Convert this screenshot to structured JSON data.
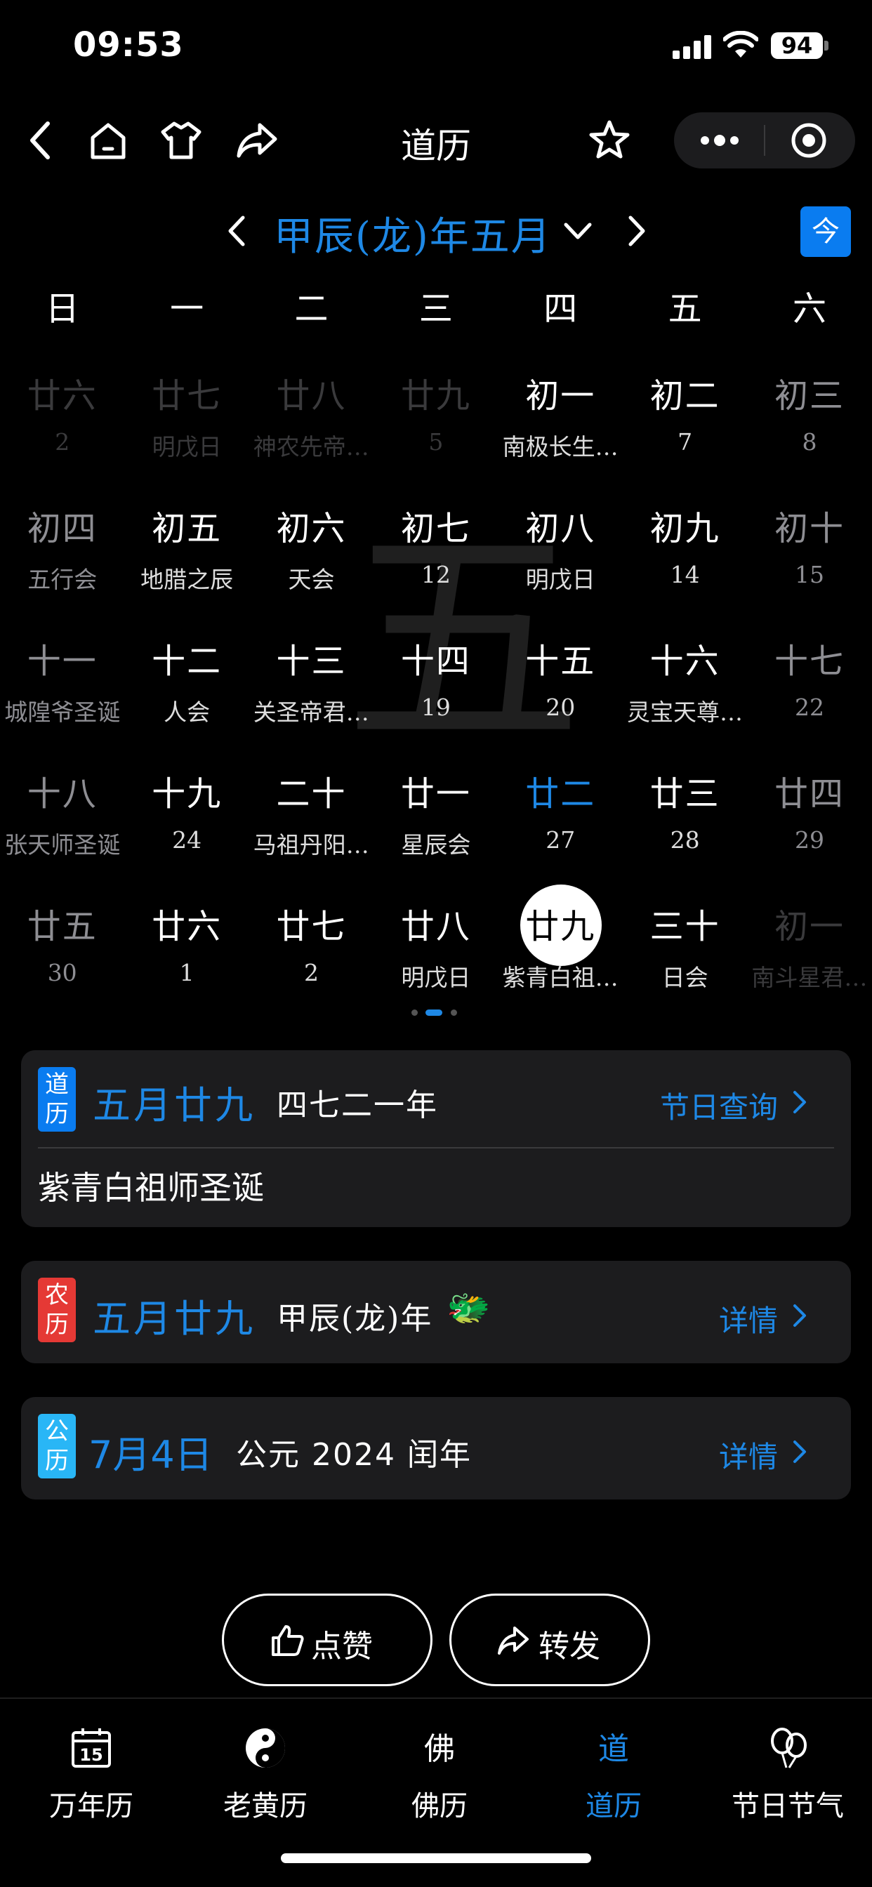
{
  "status": {
    "time": "09:53",
    "battery": "94"
  },
  "nav": {
    "title": "道历"
  },
  "month": {
    "title": "甲辰(龙)年五月",
    "today_label": "今"
  },
  "weekdays": [
    "日",
    "一",
    "二",
    "三",
    "四",
    "五",
    "六"
  ],
  "watermark": "五",
  "calendar": [
    [
      {
        "lunar": "廿六",
        "sub": "2"
      },
      {
        "lunar": "廿七",
        "sub": "明戊日"
      },
      {
        "lunar": "廿八",
        "sub": "神农先帝圣诞"
      },
      {
        "lunar": "廿九",
        "sub": "5"
      },
      {
        "lunar": "初一",
        "sub": "南极长生大帝圣诞"
      },
      {
        "lunar": "初二",
        "sub": "7"
      },
      {
        "lunar": "初三",
        "sub": "8"
      }
    ],
    [
      {
        "lunar": "初四",
        "sub": "五行会"
      },
      {
        "lunar": "初五",
        "sub": "地腊之辰"
      },
      {
        "lunar": "初六",
        "sub": "天会"
      },
      {
        "lunar": "初七",
        "sub": "12"
      },
      {
        "lunar": "初八",
        "sub": "明戊日"
      },
      {
        "lunar": "初九",
        "sub": "14"
      },
      {
        "lunar": "初十",
        "sub": "15"
      }
    ],
    [
      {
        "lunar": "十一",
        "sub": "城隍爷圣诞"
      },
      {
        "lunar": "十二",
        "sub": "人会"
      },
      {
        "lunar": "十三",
        "sub": "关圣帝君圣诞"
      },
      {
        "lunar": "十四",
        "sub": "19"
      },
      {
        "lunar": "十五",
        "sub": "20"
      },
      {
        "lunar": "十六",
        "sub": "灵宝天尊圣诞"
      },
      {
        "lunar": "十七",
        "sub": "22"
      }
    ],
    [
      {
        "lunar": "十八",
        "sub": "张天师圣诞"
      },
      {
        "lunar": "十九",
        "sub": "24"
      },
      {
        "lunar": "二十",
        "sub": "马祖丹阳真人圣诞"
      },
      {
        "lunar": "廿一",
        "sub": "星辰会"
      },
      {
        "lunar": "廿二",
        "sub": "27"
      },
      {
        "lunar": "廿三",
        "sub": "28"
      },
      {
        "lunar": "廿四",
        "sub": "29"
      }
    ],
    [
      {
        "lunar": "廿五",
        "sub": "30"
      },
      {
        "lunar": "廿六",
        "sub": "1"
      },
      {
        "lunar": "廿七",
        "sub": "2"
      },
      {
        "lunar": "廿八",
        "sub": "明戊日"
      },
      {
        "lunar": "廿九",
        "sub": "紫青白祖师圣诞"
      },
      {
        "lunar": "三十",
        "sub": "日会"
      },
      {
        "lunar": "初一",
        "sub": "南斗星君下降"
      }
    ]
  ],
  "cards": {
    "dao": {
      "badge": "道历",
      "date": "五月廿九",
      "year": "四七二一年",
      "link": "节日查询",
      "note": "紫青白祖师圣诞",
      "color": "#0a7cf0"
    },
    "nong": {
      "badge": "农历",
      "date": "五月廿九",
      "year": "甲辰(龙)年",
      "emoji": "🐲",
      "link": "详情",
      "color": "#e53935"
    },
    "gong": {
      "badge": "公历",
      "date": "7月4日",
      "year": "公元 2024 闰年",
      "link": "详情",
      "color": "#29b6f6"
    }
  },
  "actions": {
    "like": "点赞",
    "share": "转发"
  },
  "tabs": [
    "万年历",
    "老黄历",
    "佛历",
    "道历",
    "节日节气"
  ],
  "tab_icons": {
    "calendar_day": "15",
    "fo": "佛",
    "dao": "道"
  }
}
